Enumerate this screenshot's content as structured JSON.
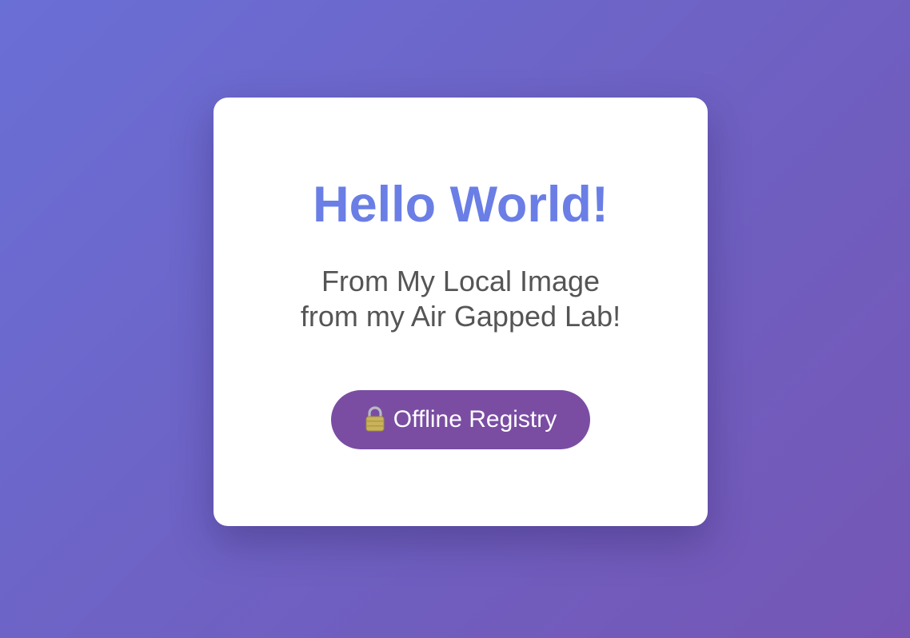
{
  "card": {
    "title": "Hello World!",
    "subtitle_line1": "From My Local Image",
    "subtitle_line2": "from my Air Gapped Lab!",
    "badge": {
      "icon": "lock-icon",
      "label": "Offline Registry"
    }
  },
  "colors": {
    "background_start": "#6a6fd6",
    "background_end": "#7556b5",
    "title": "#6a7ee6",
    "subtitle": "#555555",
    "badge_background": "#7a4da3",
    "badge_text": "#ffffff"
  }
}
